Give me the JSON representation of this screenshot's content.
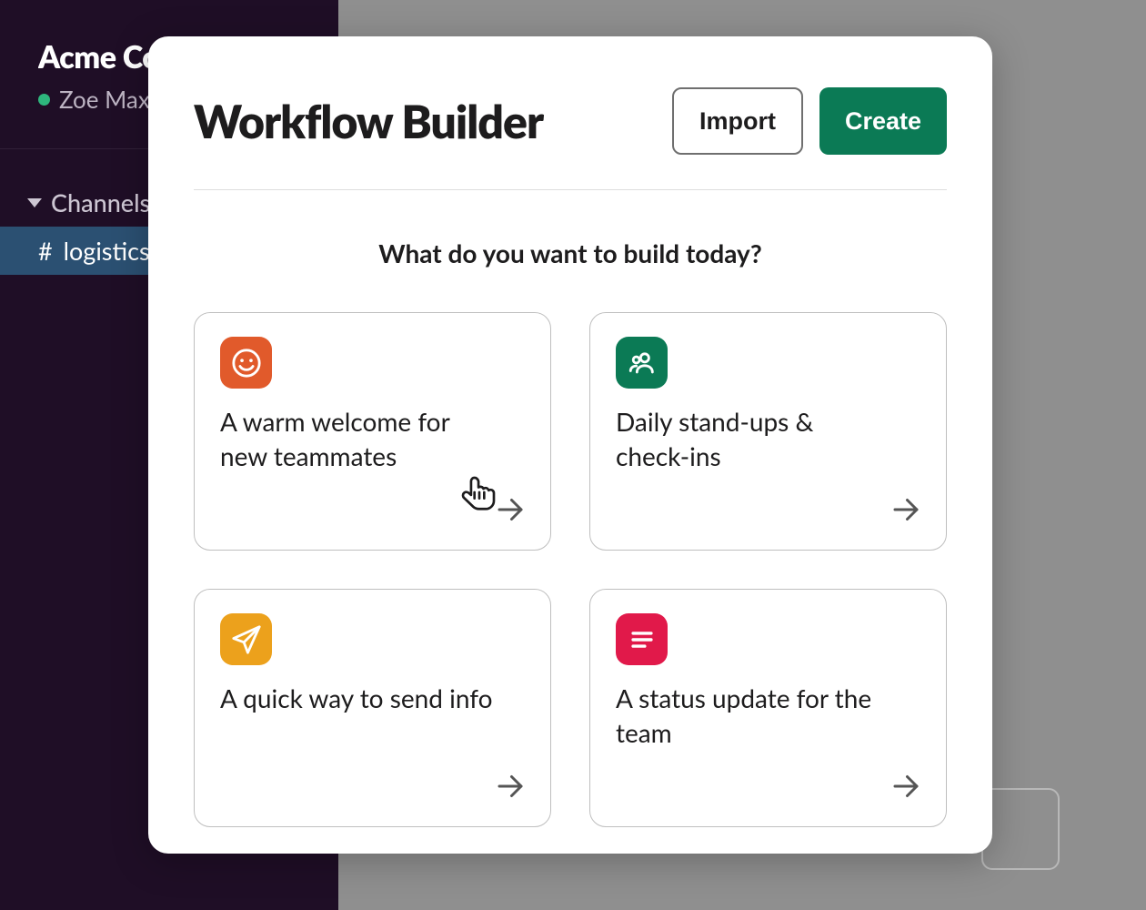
{
  "sidebar": {
    "workspace_label": "Acme Co.",
    "user_label": "Zoe Maxwell",
    "sections": {
      "channels_label": "Channels",
      "items": [
        {
          "prefix": "#",
          "label": "logistics",
          "selected": true
        }
      ]
    }
  },
  "modal": {
    "title": "Workflow Builder",
    "import_label": "Import",
    "create_label": "Create",
    "subtitle": "What do you want to build today?",
    "cards": [
      {
        "title": "A warm welcome for new teammates",
        "icon": "smiley-icon",
        "color": "orange"
      },
      {
        "title": "Daily stand-ups & check-ins",
        "icon": "people-icon",
        "color": "green"
      },
      {
        "title": "A quick way to send info",
        "icon": "paper-plane-icon",
        "color": "yellow"
      },
      {
        "title": "A status update for the team",
        "icon": "lines-icon",
        "color": "pink"
      }
    ]
  },
  "colors": {
    "orange": "#e15a2b",
    "green": "#0b7a55",
    "yellow": "#eca11c",
    "pink": "#e1194a"
  }
}
